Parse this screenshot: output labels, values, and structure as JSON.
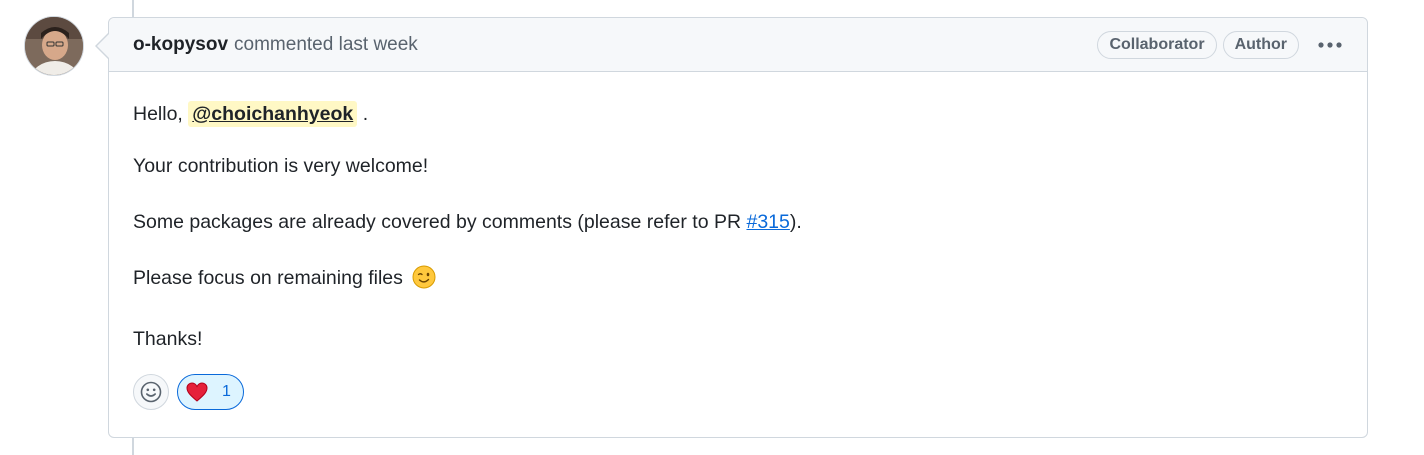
{
  "comment": {
    "author": "o-kopysov",
    "action": "commented",
    "timestamp": "last week",
    "labels": [
      "Collaborator",
      "Author"
    ],
    "menu_icon": "kebab-horizontal-icon"
  },
  "body": {
    "greeting": "Hello,",
    "mention": "@choichanhyeok",
    "greeting_end": ".",
    "line2": "Your contribution is very welcome!",
    "line3_before": "Some packages are already covered by comments (please refer to PR ",
    "line3_link": "#315",
    "line3_after": ").",
    "line4": "Please focus on remaining files",
    "line4_emoji": "wink-emoji",
    "line5": "Thanks!"
  },
  "reactions": {
    "add_icon": "smiley-icon",
    "items": [
      {
        "emoji": "heart-icon",
        "count": "1"
      }
    ]
  },
  "colors": {
    "accent": "#0969da",
    "mention_bg": "#fff8c5",
    "border": "#d0d7de",
    "header_bg": "#f6f8fa",
    "heart": "#e5203a"
  }
}
